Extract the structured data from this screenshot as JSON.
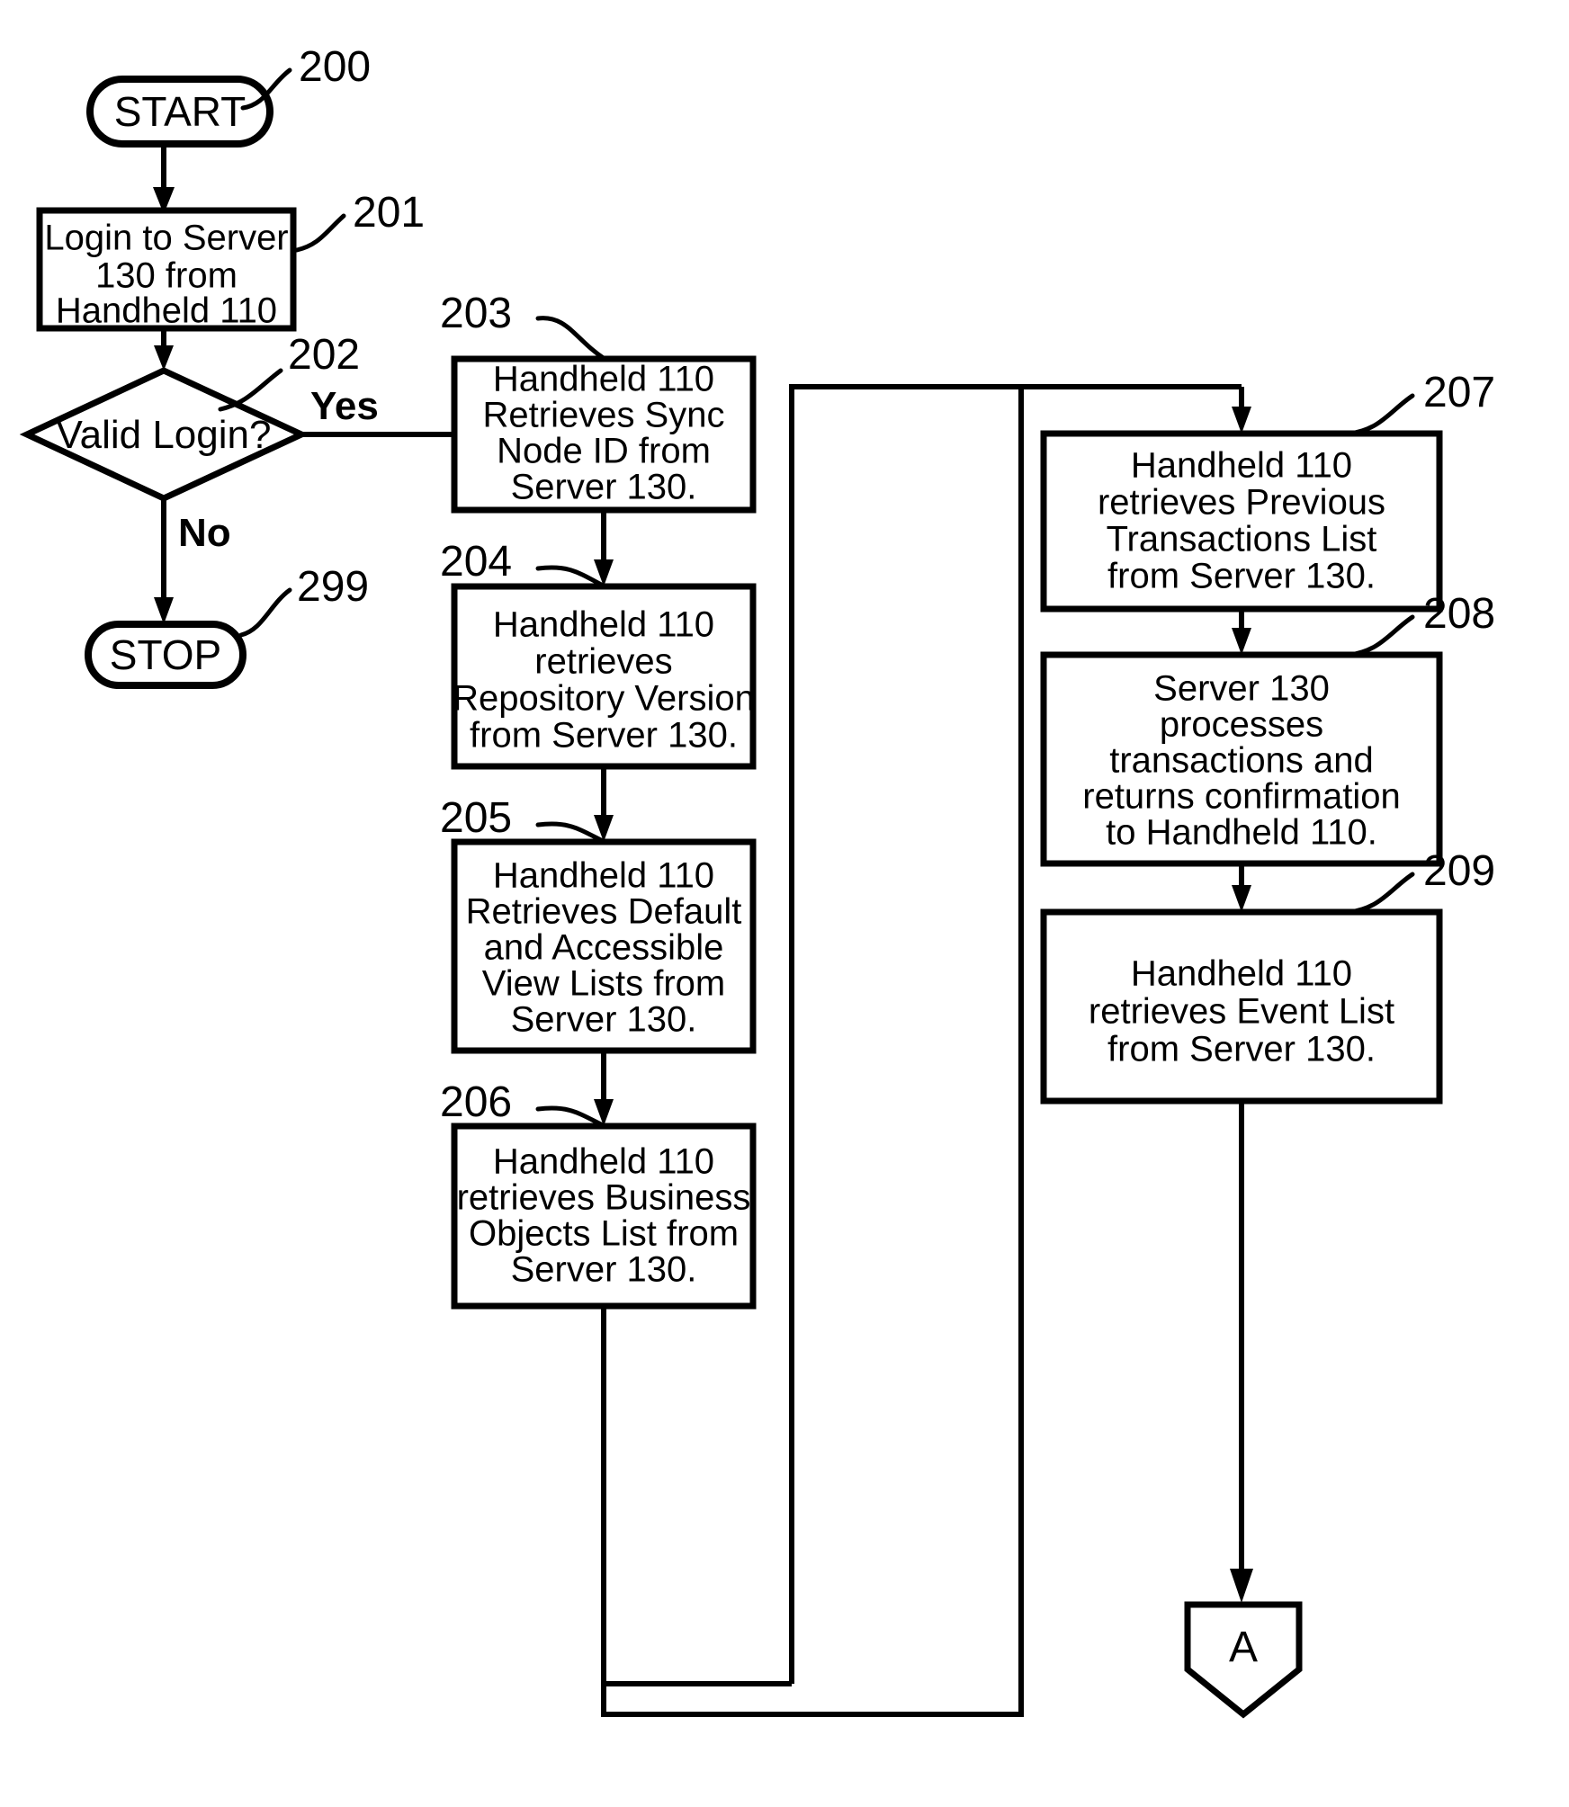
{
  "diagram": {
    "type": "flowchart",
    "title": "Handheld 110 / Server 130 synchronization flow",
    "background_color": "#ffffff",
    "line_color": "#000000"
  },
  "nodes": {
    "start": {
      "ref": "200",
      "label": "START",
      "shape": "terminator"
    },
    "login": {
      "ref": "201",
      "shape": "process",
      "lines": [
        "Login to Server",
        "130 from",
        "Handheld 110"
      ]
    },
    "decision": {
      "ref": "202",
      "shape": "decision",
      "lines": [
        "Valid Login?"
      ],
      "yes_label": "Yes",
      "no_label": "No"
    },
    "stop": {
      "ref": "299",
      "label": "STOP",
      "shape": "terminator"
    },
    "sync_node_id": {
      "ref": "203",
      "shape": "process",
      "lines": [
        "Handheld 110",
        "Retrieves Sync",
        "Node ID from",
        "Server 130."
      ]
    },
    "repository_version": {
      "ref": "204",
      "shape": "process",
      "lines": [
        "Handheld 110",
        "retrieves",
        "Repository Version",
        "from Server 130."
      ]
    },
    "view_lists": {
      "ref": "205",
      "shape": "process",
      "lines": [
        "Handheld 110",
        "Retrieves Default",
        "and Accessible",
        "View Lists from",
        "Server 130."
      ]
    },
    "business_objects": {
      "ref": "206",
      "shape": "process",
      "lines": [
        "Handheld 110",
        "retrieves Business",
        "Objects List from",
        "Server 130."
      ]
    },
    "previous_transactions": {
      "ref": "207",
      "shape": "process",
      "lines": [
        "Handheld 110",
        "retrieves Previous",
        "Transactions List",
        "from Server 130."
      ]
    },
    "process_transactions": {
      "ref": "208",
      "shape": "process",
      "lines": [
        "Server 130",
        "processes",
        "transactions and",
        "returns confirmation",
        "to Handheld 110."
      ]
    },
    "event_list": {
      "ref": "209",
      "shape": "process",
      "lines": [
        "Handheld 110",
        "retrieves Event List",
        "from Server 130."
      ]
    },
    "connector_a": {
      "label": "A",
      "shape": "off-page-connector"
    }
  },
  "reference_numbers": [
    "200",
    "201",
    "202",
    "299",
    "203",
    "204",
    "205",
    "206",
    "207",
    "208",
    "209"
  ],
  "edge_labels": [
    "Yes",
    "No"
  ]
}
